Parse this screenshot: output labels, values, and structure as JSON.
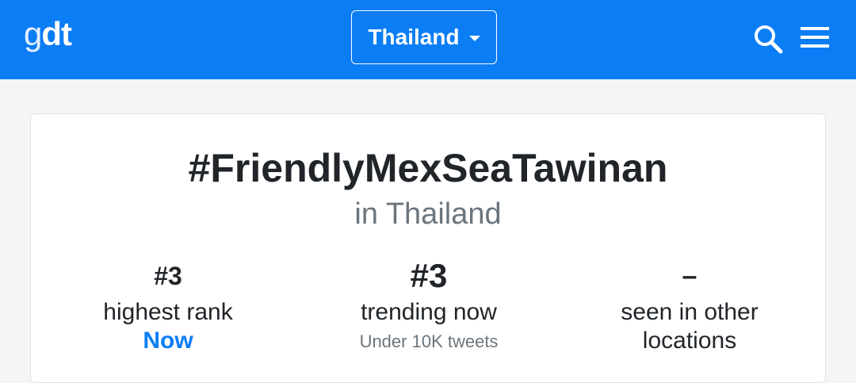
{
  "header": {
    "logo_g": "g",
    "logo_dt": "dt",
    "location_label": "Thailand",
    "icons": [
      "search-icon",
      "menu-icon"
    ],
    "background_color": "#0b7df5"
  },
  "trend": {
    "hashtag": "#FriendlyMexSeaTawinan",
    "location": "in Thailand"
  },
  "stats": {
    "highest_rank": {
      "value": "#3",
      "label": "highest rank",
      "when": "Now"
    },
    "trending_now": {
      "value": "#3",
      "label": "trending now",
      "tweets": "Under 10K tweets"
    },
    "other_locations": {
      "value": "–",
      "label_line1": "seen in other",
      "label_line2": "locations"
    }
  },
  "colors": {
    "accent": "#0b7df5",
    "text": "#212529",
    "muted": "#6c757d"
  }
}
